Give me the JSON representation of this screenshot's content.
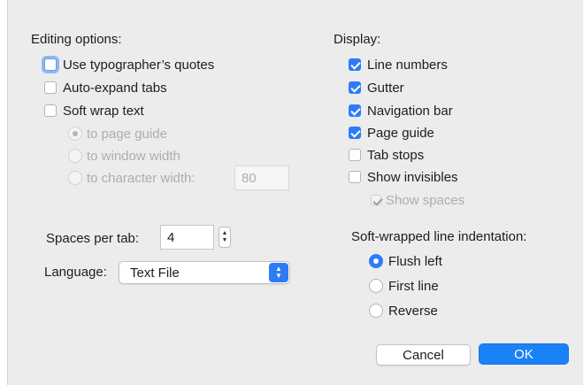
{
  "editing": {
    "heading": "Editing options:",
    "use_quotes": "Use typographer’s quotes",
    "auto_expand": "Auto-expand tabs",
    "soft_wrap": "Soft wrap text",
    "wrap_page_guide": "to page guide",
    "wrap_window": "to window width",
    "wrap_char": "to character width:",
    "char_width_value": "80",
    "spaces_label": "Spaces per tab:",
    "spaces_value": "4",
    "language_label": "Language:",
    "language_value": "Text File"
  },
  "display": {
    "heading": "Display:",
    "line_numbers": "Line numbers",
    "gutter": "Gutter",
    "navigation_bar": "Navigation bar",
    "page_guide": "Page guide",
    "tab_stops": "Tab stops",
    "show_invisibles": "Show invisibles",
    "show_spaces": "Show spaces"
  },
  "indent": {
    "heading": "Soft-wrapped line indentation:",
    "flush_left": "Flush left",
    "first_line": "First line",
    "reverse": "Reverse"
  },
  "buttons": {
    "cancel": "Cancel",
    "ok": "OK"
  },
  "colors": {
    "accent": "#2d7cf6",
    "background": "#ececec"
  }
}
